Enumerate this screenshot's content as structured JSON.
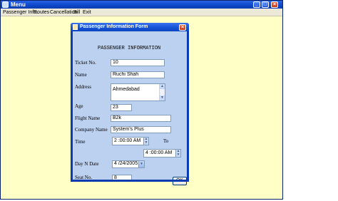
{
  "app": {
    "title": "Menu"
  },
  "menubar": [
    "Passenger Info..",
    "Routes",
    "Cancellation",
    "Bill",
    "Exit"
  ],
  "dialog": {
    "title": "Passenger Information Form",
    "heading": "PASSENGER INFORMATION",
    "ticket_label": "Ticket No.",
    "ticket_value": "10",
    "name_label": "Name",
    "name_value": "Ruchi Shah",
    "address_label": "Address",
    "address_value": "Ahmedabad",
    "age_label": "Age",
    "age_value": "23",
    "flight_label": "Flight Name",
    "flight_value": "B2k",
    "company_label": "Company Name",
    "company_value": "System's Plus",
    "time_label": "Time",
    "time_from": "2 :00:00 AM",
    "to_label": "To",
    "time_to": "4 :00:00 AM",
    "date_label": "Day N Date",
    "date_value": "4 /24/2005",
    "seat_label": "Seat No.",
    "seat_value": "8",
    "ok_label": "OK"
  }
}
